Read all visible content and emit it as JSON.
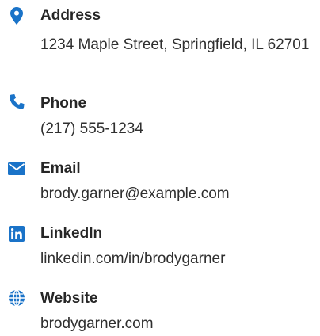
{
  "accent_color": "#1a73c8",
  "contacts": [
    {
      "icon": "map-pin-icon",
      "label": "Address",
      "value": "1234 Maple Street, Springfield, IL 62701"
    },
    {
      "icon": "phone-icon",
      "label": "Phone",
      "value": "(217) 555-1234"
    },
    {
      "icon": "envelope-icon",
      "label": "Email",
      "value": "brody.garner@example.com"
    },
    {
      "icon": "linkedin-icon",
      "label": "LinkedIn",
      "value": "linkedin.com/in/brodygarner"
    },
    {
      "icon": "globe-icon",
      "label": "Website",
      "value": "brodygarner.com"
    }
  ]
}
